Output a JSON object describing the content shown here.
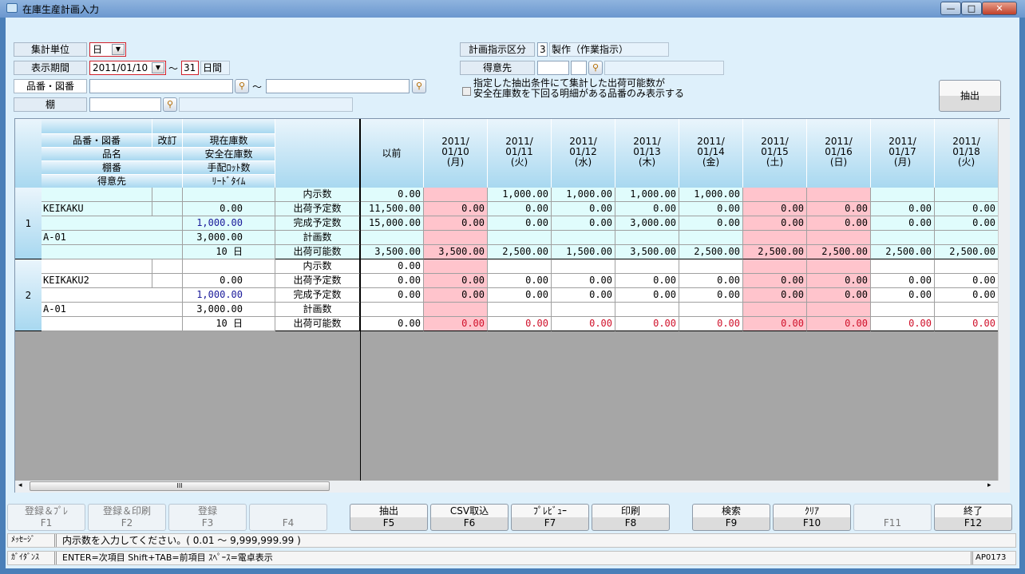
{
  "window": {
    "title": "在庫生産計画入力",
    "min": "—",
    "max": "□",
    "close": "✕"
  },
  "filters": {
    "unit_label": "集計単位",
    "unit_value": "日",
    "period_label": "表示期間",
    "period_start": "2011/01/10",
    "tilde": "～",
    "period_days": "31",
    "days_suffix": "日間",
    "part_label": "品番・図番",
    "part_from": "",
    "part_to": "",
    "shelf_label": "棚",
    "shelf_value": "",
    "plan_type_label": "計画指示区分",
    "plan_type_code": "3",
    "plan_type_name": "製作（作業指示）",
    "customer_label": "得意先",
    "customer_code1": "",
    "customer_code2": "",
    "checkbox_line1": "指定した抽出条件にて集計した出荷可能数が",
    "checkbox_line2": "安全在庫数を下回る明細がある品番のみ表示する",
    "extract_button": "抽出"
  },
  "grid": {
    "headers": {
      "part": "品番・図番",
      "rev": "改訂",
      "stock": "現在庫数",
      "name": "品名",
      "safety": "安全在庫数",
      "shelf": "棚番",
      "lot": "手配ﾛｯﾄ数",
      "customer": "得意先",
      "lead": "ﾘｰﾄﾞﾀｲﾑ",
      "before": "以前"
    },
    "dates": [
      [
        "2011/",
        "01/10",
        "(月)"
      ],
      [
        "2011/",
        "01/11",
        "(火)"
      ],
      [
        "2011/",
        "01/12",
        "(水)"
      ],
      [
        "2011/",
        "01/13",
        "(木)"
      ],
      [
        "2011/",
        "01/14",
        "(金)"
      ],
      [
        "2011/",
        "01/15",
        "(土)"
      ],
      [
        "2011/",
        "01/16",
        "(日)"
      ],
      [
        "2011/",
        "01/17",
        "(月)"
      ],
      [
        "2011/",
        "01/18",
        "(火)"
      ]
    ],
    "holiday_columns": [
      0,
      5,
      6
    ],
    "row_labels": [
      "内示数",
      "出荷予定数",
      "完成予定数",
      "計画数",
      "出荷可能数"
    ],
    "items": [
      {
        "no": "1",
        "part": "KEIKAKU",
        "rev": "",
        "name": "",
        "stock": "0.00",
        "safety": "1,000.00",
        "shelf": "A-01",
        "lot": "3,000.00",
        "customer": "",
        "lead": "10 日",
        "rows": [
          [
            "0.00",
            "",
            "1,000.00",
            "1,000.00",
            "1,000.00",
            "1,000.00",
            "",
            "",
            "",
            ""
          ],
          [
            "11,500.00",
            "0.00",
            "0.00",
            "0.00",
            "0.00",
            "0.00",
            "0.00",
            "0.00",
            "0.00",
            "0.00"
          ],
          [
            "15,000.00",
            "0.00",
            "0.00",
            "0.00",
            "3,000.00",
            "0.00",
            "0.00",
            "0.00",
            "0.00",
            "0.00"
          ],
          [
            "",
            "",
            "",
            "",
            "",
            "",
            "",
            "",
            "",
            ""
          ],
          [
            "3,500.00",
            "3,500.00",
            "2,500.00",
            "1,500.00",
            "3,500.00",
            "2,500.00",
            "2,500.00",
            "2,500.00",
            "2,500.00",
            "2,500.00"
          ]
        ]
      },
      {
        "no": "2",
        "part": "KEIKAKU2",
        "rev": "",
        "name": "",
        "stock": "0.00",
        "safety": "1,000.00",
        "shelf": "A-01",
        "lot": "3,000.00",
        "customer": "",
        "lead": "10 日",
        "rows": [
          [
            "0.00",
            "",
            "",
            "",
            "",
            "",
            "",
            "",
            "",
            ""
          ],
          [
            "0.00",
            "0.00",
            "0.00",
            "0.00",
            "0.00",
            "0.00",
            "0.00",
            "0.00",
            "0.00",
            "0.00"
          ],
          [
            "0.00",
            "0.00",
            "0.00",
            "0.00",
            "0.00",
            "0.00",
            "0.00",
            "0.00",
            "0.00",
            "0.00"
          ],
          [
            "",
            "",
            "",
            "",
            "",
            "",
            "",
            "",
            "",
            ""
          ],
          [
            "0.00",
            "0.00",
            "0.00",
            "0.00",
            "0.00",
            "0.00",
            "0.00",
            "0.00",
            "0.00",
            "0.00"
          ]
        ]
      }
    ],
    "scroll_grip": "III"
  },
  "fkeys": [
    {
      "label": "登録＆ﾌﾟﾚ",
      "key": "F1",
      "enabled": false
    },
    {
      "label": "登録＆印刷",
      "key": "F2",
      "enabled": false
    },
    {
      "label": "登録",
      "key": "F3",
      "enabled": false
    },
    {
      "label": "",
      "key": "F4",
      "enabled": false
    },
    {
      "label": "抽出",
      "key": "F5",
      "enabled": true
    },
    {
      "label": "CSV取込",
      "key": "F6",
      "enabled": true
    },
    {
      "label": "ﾌﾟﾚﾋﾞｭｰ",
      "key": "F7",
      "enabled": true
    },
    {
      "label": "印刷",
      "key": "F8",
      "enabled": true
    },
    {
      "label": "検索",
      "key": "F9",
      "enabled": true
    },
    {
      "label": "ｸﾘｱ",
      "key": "F10",
      "enabled": true
    },
    {
      "label": "",
      "key": "F11",
      "enabled": false
    },
    {
      "label": "終了",
      "key": "F12",
      "enabled": true
    }
  ],
  "status": {
    "message_label": "ﾒｯｾｰｼﾞ",
    "message": "内示数を入力してください。( 0.01 ～ 9,999,999.99 )",
    "guidance_label": "ｶﾞｲﾀﾞﾝｽ",
    "guidance": "ENTER=次項目  Shift+TAB=前項目  ｽﾍﾟｰｽ=電卓表示",
    "screen_id": "AP0173"
  }
}
